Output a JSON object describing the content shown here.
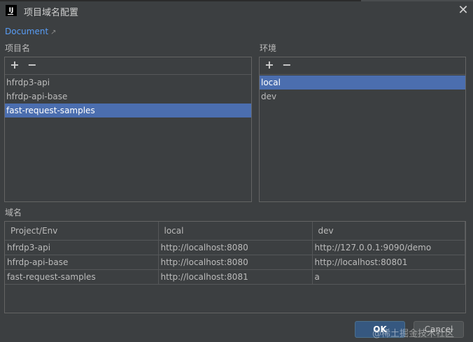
{
  "window": {
    "title": "项目域名配置",
    "logo_text": "IJ",
    "close_glyph": "✕"
  },
  "doc_link": {
    "label": "Document",
    "arrow": "↗"
  },
  "projects": {
    "label": "项目名",
    "add_glyph": "+",
    "remove_glyph": "−",
    "items": [
      "hfrdp3-api",
      "hfrdp-api-base",
      "fast-request-samples"
    ],
    "selected": "fast-request-samples"
  },
  "envs": {
    "label": "环境",
    "add_glyph": "+",
    "remove_glyph": "−",
    "items": [
      "local",
      "dev"
    ],
    "selected": "local"
  },
  "domains": {
    "label": "域名",
    "columns": [
      "Project/Env",
      "local",
      "dev"
    ],
    "rows": [
      [
        "hfrdp3-api",
        "http://localhost:8080",
        "http://127.0.0.1:9090/demo"
      ],
      [
        "hfrdp-api-base",
        "http://localhost:8080",
        "http://localhost:80801"
      ],
      [
        "fast-request-samples",
        "http://localhost:8081",
        "a"
      ]
    ]
  },
  "buttons": {
    "ok": "OK",
    "cancel": "Cancel"
  },
  "watermark": "@稀土掘金技术社区",
  "colors": {
    "background": "#3c3f41",
    "selection": "#4b6eaf",
    "link": "#589df6",
    "ok_button": "#365880"
  }
}
